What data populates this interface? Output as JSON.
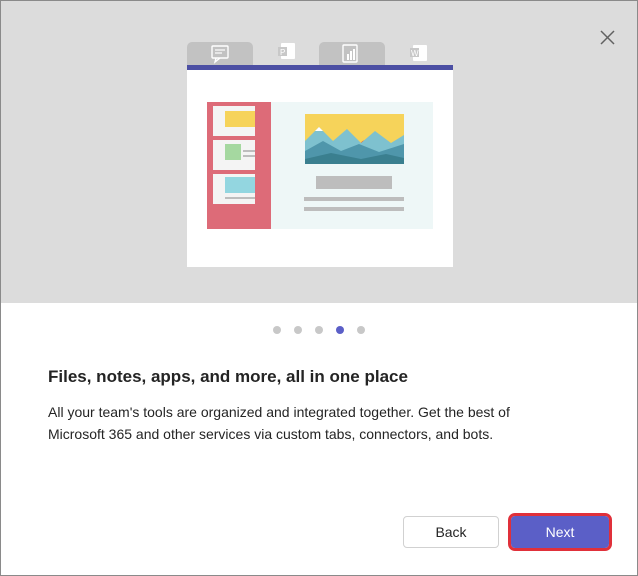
{
  "dialog": {
    "close_icon": "close-icon",
    "illustration": {
      "tab_icons": [
        "chat-icon",
        "powerpoint-icon",
        "power-bi-icon",
        "word-icon"
      ]
    },
    "pager": {
      "count": 5,
      "active_index": 3
    },
    "title": "Files, notes, apps, and more, all in one place",
    "description": "All your team's tools are organized and integrated together. Get the best of Microsoft 365 and other services via custom tabs, connectors, and bots.",
    "buttons": {
      "back_label": "Back",
      "next_label": "Next"
    }
  },
  "colors": {
    "accent": "#5b5fc7",
    "highlight": "#e0303a",
    "hero_background": "#dcdcdc"
  }
}
